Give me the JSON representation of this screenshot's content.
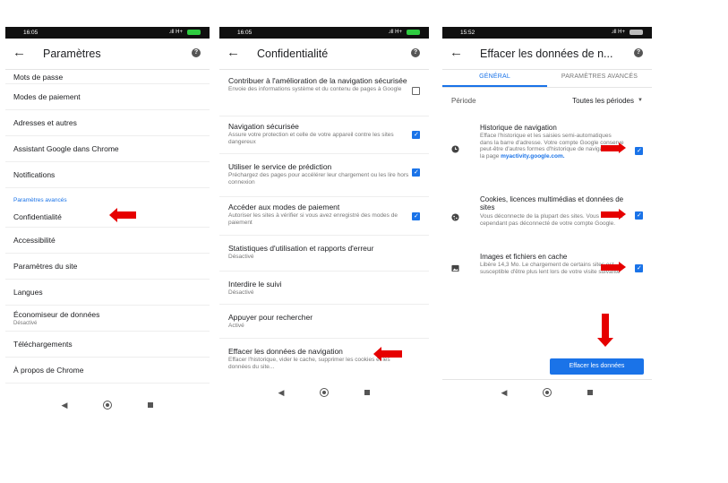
{
  "colors": {
    "accent": "#1a73e8",
    "annotation_red": "#e60000",
    "status_bar": "#101010"
  },
  "icons": {
    "back": "arrow-left-icon",
    "help": "help-icon",
    "nav_back": "triangle-back-icon",
    "nav_home": "circle-home-icon",
    "nav_recent": "square-recent-icon"
  },
  "panel1": {
    "status_time": "16:05",
    "status_signal": ".ıll H+",
    "status_battery": "",
    "title": "Paramètres",
    "items_top": [
      {
        "label": "Mots de passe"
      },
      {
        "label": "Modes de paiement"
      },
      {
        "label": "Adresses et autres"
      },
      {
        "label": "Assistant Google dans Chrome"
      },
      {
        "label": "Notifications"
      }
    ],
    "section": "Paramètres avancés",
    "items_bottom": [
      {
        "label": "Confidentialité",
        "sub": ""
      },
      {
        "label": "Accessibilité",
        "sub": ""
      },
      {
        "label": "Paramètres du site",
        "sub": ""
      },
      {
        "label": "Langues",
        "sub": ""
      },
      {
        "label": "Économiseur de données",
        "sub": "Désactivé"
      },
      {
        "label": "Téléchargements",
        "sub": ""
      },
      {
        "label": "À propos de Chrome",
        "sub": ""
      }
    ]
  },
  "panel2": {
    "status_time": "16:05",
    "status_signal": ".ıll H+",
    "title": "Confidentialité",
    "items": [
      {
        "title": "Contribuer à l'amélioration de la navigation sécurisée",
        "desc": "Envoie des informations système et du contenu de pages à Google",
        "checked": false
      },
      {
        "title": "Navigation sécurisée",
        "desc": "Assure votre protection et celle de votre appareil contre les sites dangereux",
        "checked": true
      },
      {
        "title": "Utiliser le service de prédiction",
        "desc": "Préchargez des pages pour accélérer leur chargement ou les lire hors connexion",
        "checked": true
      },
      {
        "title": "Accéder aux modes de paiement",
        "desc": "Autoriser les sites à vérifier si vous avez enregistré des modes de paiement",
        "checked": true
      },
      {
        "title": "Statistiques d'utilisation et rapports d'erreur",
        "desc": "Désactivé"
      },
      {
        "title": "Interdire le suivi",
        "desc": "Désactivé"
      },
      {
        "title": "Appuyer pour rechercher",
        "desc": "Activé"
      },
      {
        "title": "Effacer les données de navigation",
        "desc": "Effacer l'historique, vider le cache, supprimer les cookies et les données du site..."
      }
    ]
  },
  "panel3": {
    "status_time": "15:52",
    "status_signal": ".ıll H+",
    "title": "Effacer les données de n...",
    "tabs": [
      "GÉNÉRAL",
      "PARAMÈTRES AVANCÉS"
    ],
    "period_label": "Période",
    "period_value": "Toutes les périodes",
    "items": [
      {
        "title": "Historique de navigation",
        "desc": "Efface l'historique et les saisies semi-automatiques dans la barre d'adresse. Votre compte Google conserve peut-être d'autres formes d'historique de navigation sur la page",
        "link": "myactivity.google.com.",
        "checked": true
      },
      {
        "title": "Cookies, licences multimédias et données de sites",
        "desc": "Vous déconnecte de la plupart des sites. Vous ne serez cependant pas déconnecté de votre compte Google.",
        "checked": true
      },
      {
        "title": "Images et fichiers en cache",
        "desc": "Libère 14,3 Mo. Le chargement de certains sites est susceptible d'être plus lent lors de votre visite suivante",
        "checked": true
      }
    ],
    "button": "Effacer les données"
  }
}
